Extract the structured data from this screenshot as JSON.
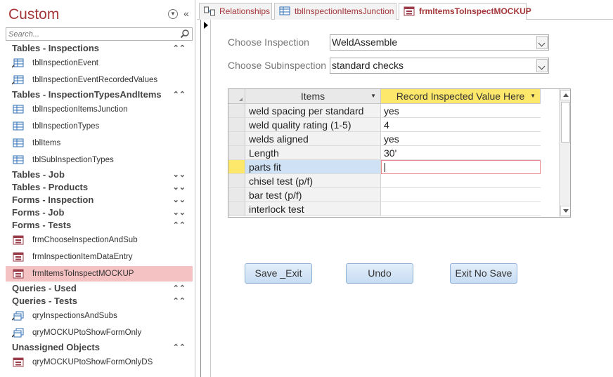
{
  "nav": {
    "title": "Custom",
    "search_placeholder": "Search...",
    "groups": [
      {
        "label": "Tables - Inspections",
        "expanded": true
      },
      {
        "label": "Tables - InspectionTypesAndItems",
        "expanded": true
      },
      {
        "label": "Tables - Job",
        "expanded": false
      },
      {
        "label": "Tables - Products",
        "expanded": false
      },
      {
        "label": "Forms - Inspection",
        "expanded": false
      },
      {
        "label": "Forms - Job",
        "expanded": false
      },
      {
        "label": "Forms - Tests",
        "expanded": true
      },
      {
        "label": "Queries - Used",
        "expanded": true
      },
      {
        "label": "Queries - Tests",
        "expanded": true
      },
      {
        "label": "Unassigned Objects",
        "expanded": true
      }
    ],
    "objects": [
      {
        "label": "tblInspectionEvent",
        "icon": "linked-table-icon"
      },
      {
        "label": "tblInspectionEventRecordedValues",
        "icon": "linked-table-icon"
      },
      {
        "label": "tblInspectionItemsJunction",
        "icon": "table-icon"
      },
      {
        "label": "tblInspectionTypes",
        "icon": "table-icon"
      },
      {
        "label": "tblItems",
        "icon": "table-icon"
      },
      {
        "label": "tblSubInspectionTypes",
        "icon": "table-icon"
      },
      {
        "label": "frmChooseInspectionAndSub",
        "icon": "form-icon"
      },
      {
        "label": "frmInspectionItemDataEntry",
        "icon": "form-icon"
      },
      {
        "label": "frmItemsToInspectMOCKUP",
        "icon": "form-icon"
      },
      {
        "label": "qryInspectionsAndSubs",
        "icon": "query-icon"
      },
      {
        "label": "qryMOCKUPtoShowFormOnly",
        "icon": "query-icon"
      },
      {
        "label": "qryMOCKUPtoShowFormOnlyDS",
        "icon": "form-icon"
      }
    ]
  },
  "tabs": [
    {
      "label": "Relationships",
      "icon": "relationships-icon"
    },
    {
      "label": "tblInspectionItemsJunction",
      "icon": "table-icon"
    },
    {
      "label": "frmItemsToInspectMOCKUP",
      "icon": "form-icon"
    }
  ],
  "form": {
    "choose_inspection_label": "Choose Inspection",
    "choose_inspection_value": "WeldAssemble",
    "choose_subinspection_label": "Choose Subinspection",
    "choose_subinspection_value": "standard checks",
    "sheet": {
      "col_items": "Items",
      "col_record": "Record Inspected Value Here",
      "rows": [
        {
          "item": "weld spacing per standard",
          "value": "yes"
        },
        {
          "item": "weld quality rating (1-5)",
          "value": "4"
        },
        {
          "item": "welds aligned",
          "value": "yes"
        },
        {
          "item": "Length",
          "value": "30'"
        },
        {
          "item": "parts fit",
          "value": ""
        },
        {
          "item": "chisel test (p/f)",
          "value": ""
        },
        {
          "item": "bar test (p/f)",
          "value": ""
        },
        {
          "item": "interlock test",
          "value": ""
        }
      ]
    },
    "buttons": {
      "save_exit": "Save _Exit",
      "undo": "Undo",
      "exit_no_save": "Exit No Save"
    }
  },
  "colors": {
    "accent": "#a4373a",
    "selected_nav": "#f5c2c3",
    "header_highlight": "#fde86b",
    "current_row": "#cfe2f5"
  }
}
